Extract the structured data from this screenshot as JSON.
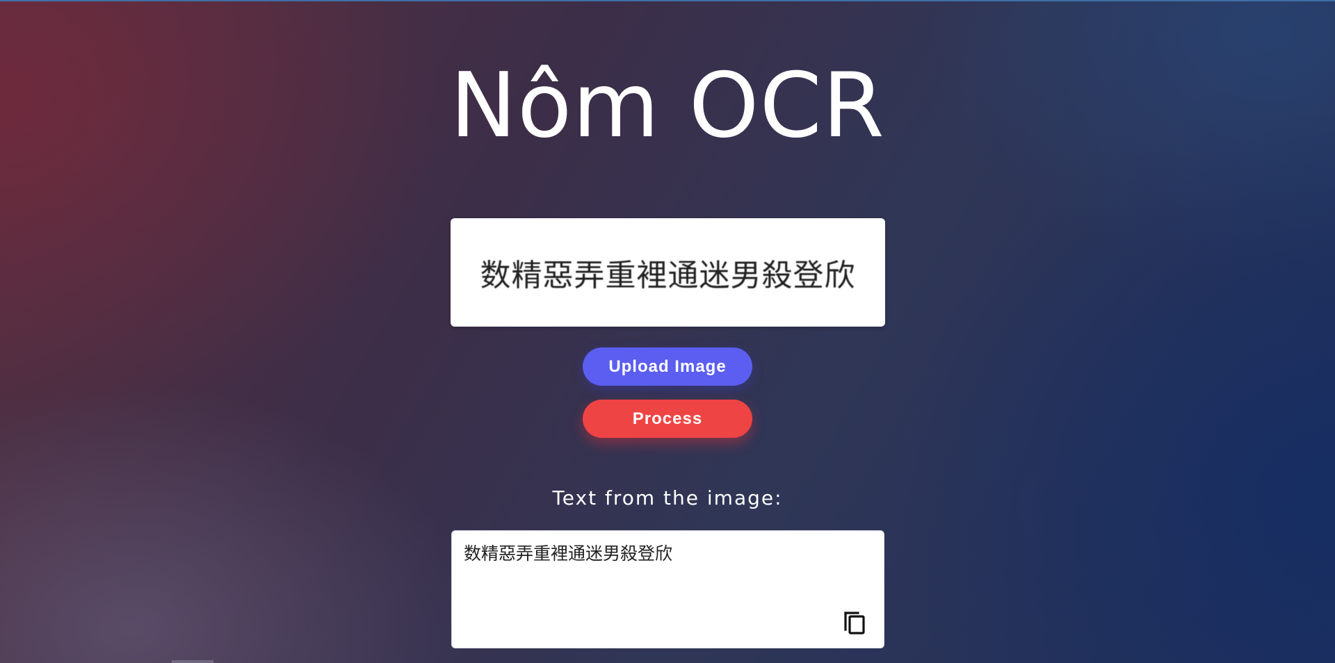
{
  "page": {
    "title": "Nôm OCR"
  },
  "preview": {
    "image_text": "数精惡弄重裡通迷男殺登欣"
  },
  "buttons": {
    "upload_label": "Upload Image",
    "process_label": "Process"
  },
  "result": {
    "label": "Text from the image:",
    "text": "数精惡弄重裡通迷男殺登欣"
  },
  "colors": {
    "upload_button": "#5b5ef0",
    "process_button": "#ef4444",
    "title_text": "#ffffff"
  },
  "icons": {
    "copy": "copy-icon"
  }
}
